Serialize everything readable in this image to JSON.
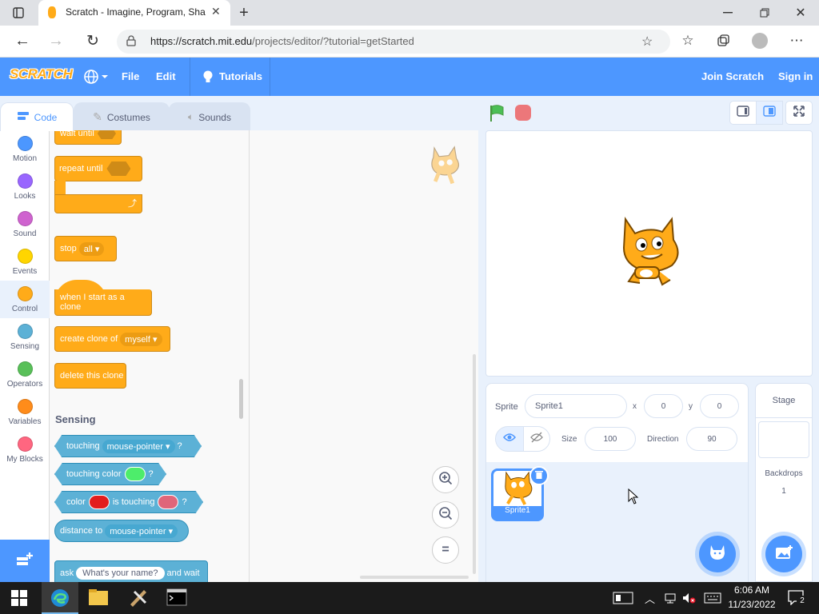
{
  "browser": {
    "tab_title": "Scratch - Imagine, Program, Sha",
    "url_host": "https://scratch.mit.edu",
    "url_path": "/projects/editor/?tutorial=getStarted",
    "window_controls": [
      "minimize-icon",
      "restore-icon",
      "close-icon"
    ]
  },
  "menubar": {
    "logo": "SCRATCH",
    "items": [
      "File",
      "Edit"
    ],
    "tutorials": "Tutorials",
    "join": "Join Scratch",
    "signin": "Sign in",
    "color": "#4d97ff"
  },
  "editor_tabs": [
    "Code",
    "Costumes",
    "Sounds"
  ],
  "categories": [
    {
      "label": "Motion",
      "color": "#4c97ff"
    },
    {
      "label": "Looks",
      "color": "#9966ff"
    },
    {
      "label": "Sound",
      "color": "#cf63cf"
    },
    {
      "label": "Events",
      "color": "#ffd500"
    },
    {
      "label": "Control",
      "color": "#ffab19"
    },
    {
      "label": "Sensing",
      "color": "#5cb1d6"
    },
    {
      "label": "Operators",
      "color": "#59c059"
    },
    {
      "label": "Variables",
      "color": "#ff8c1a"
    },
    {
      "label": "My Blocks",
      "color": "#ff6680"
    }
  ],
  "blocks": {
    "wait_until": "wait until",
    "repeat_until": "repeat until",
    "stop": "stop",
    "stop_option": "all",
    "when_clone": "when I start as a clone",
    "create_clone": "create clone of",
    "create_clone_option": "myself",
    "delete_clone": "delete this clone",
    "sensing_heading": "Sensing",
    "touching": "touching",
    "touching_option": "mouse-pointer",
    "question_mark": "?",
    "touching_color": "touching color",
    "color_word": "color",
    "is_touching": "is touching",
    "distance_to": "distance to",
    "distance_option": "mouse-pointer",
    "ask": "ask",
    "ask_default": "What's your name?",
    "and_wait": "and wait"
  },
  "sprite_info": {
    "sprite_label": "Sprite",
    "sprite_name": "Sprite1",
    "x_label": "x",
    "x_value": "0",
    "y_label": "y",
    "y_value": "0",
    "size_label": "Size",
    "size_value": "100",
    "direction_label": "Direction",
    "direction_value": "90",
    "thumbnail_name": "Sprite1"
  },
  "stage_panel": {
    "label": "Stage",
    "backdrops_label": "Backdrops",
    "backdrops_count": "1"
  },
  "taskbar": {
    "time": "6:06 AM",
    "date": "11/23/2022",
    "notifications": "2"
  }
}
